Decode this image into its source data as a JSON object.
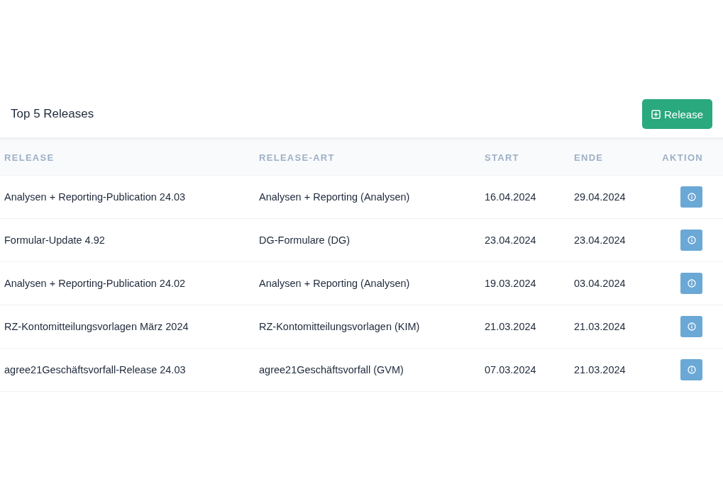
{
  "card": {
    "title": "Top 5 Releases",
    "add_button": {
      "label": "Release"
    }
  },
  "table": {
    "columns": [
      "RELEASE",
      "RELEASE-ART",
      "START",
      "ENDE",
      "AKTION"
    ],
    "rows": [
      {
        "release": "Analysen + Reporting-Publication 24.03",
        "type": "Analysen + Reporting (Analysen)",
        "start": "16.04.2024",
        "end": "29.04.2024"
      },
      {
        "release": "Formular-Update 4.92",
        "type": "DG-Formulare (DG)",
        "start": "23.04.2024",
        "end": "23.04.2024"
      },
      {
        "release": "Analysen + Reporting-Publication 24.02",
        "type": "Analysen + Reporting (Analysen)",
        "start": "19.03.2024",
        "end": "03.04.2024"
      },
      {
        "release": "RZ-Kontomitteilungsvorlagen März 2024",
        "type": "RZ-Kontomitteilungsvorlagen (KIM)",
        "start": "21.03.2024",
        "end": "21.03.2024"
      },
      {
        "release": "agree21Geschäftsvorfall-Release 24.03",
        "type": "agree21Geschäftsvorfall (GVM)",
        "start": "07.03.2024",
        "end": "21.03.2024"
      }
    ]
  }
}
